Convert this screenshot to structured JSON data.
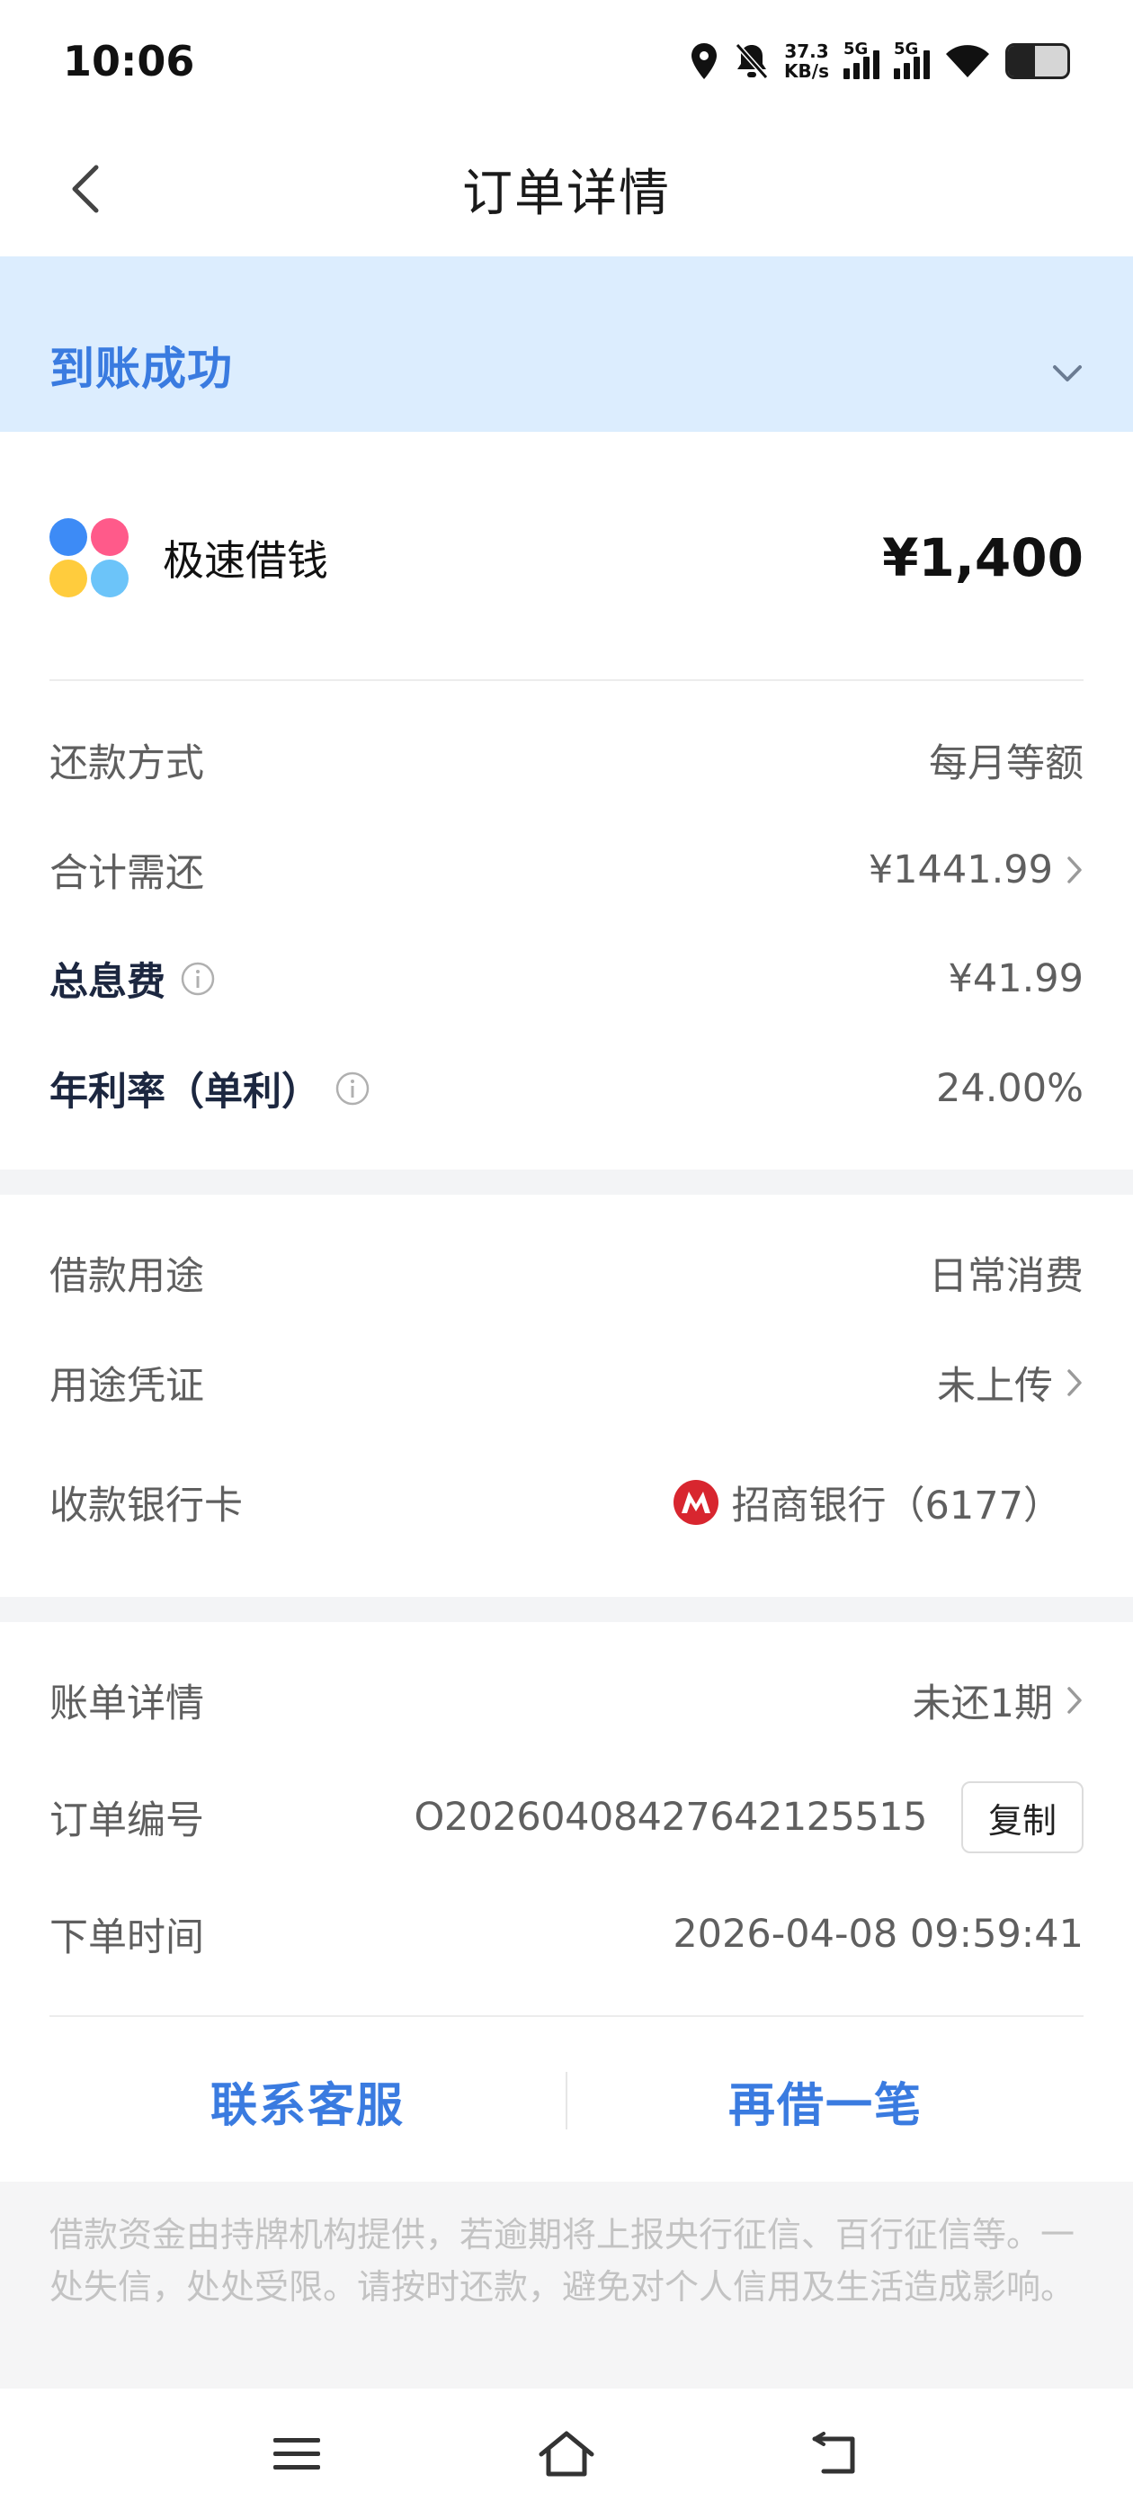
{
  "status_bar": {
    "time": "10:06",
    "net_speed_value": "37.3",
    "net_speed_unit": "KB/s",
    "signal_1": "5G",
    "signal_2": "5G",
    "battery_level": 0.45
  },
  "header": {
    "title": "订单详情"
  },
  "banner": {
    "status": "到账成功"
  },
  "product": {
    "name": "极速借钱",
    "amount": "¥1,400",
    "logo_colors": [
      "#3d8bf6",
      "#ff5a8a",
      "#ffcc3d",
      "#6cc4f9"
    ]
  },
  "section1": {
    "repay_method_label": "还款方式",
    "repay_method_value": "每月等额",
    "total_due_label": "合计需还",
    "total_due_value": "¥1441.99",
    "total_interest_label": "总息费",
    "total_interest_value": "¥41.99",
    "annual_rate_label": "年利率（单利）",
    "annual_rate_value": "24.00%"
  },
  "section2": {
    "purpose_label": "借款用途",
    "purpose_value": "日常消费",
    "voucher_label": "用途凭证",
    "voucher_value": "未上传",
    "bank_label": "收款银行卡",
    "bank_value": "招商银行（6177）"
  },
  "section3": {
    "bill_label": "账单详情",
    "bill_value": "未还1期",
    "order_no_label": "订单编号",
    "order_no_value": "O202604084276421255 15",
    "copy_label": "复制",
    "order_time_label": "下单时间",
    "order_time_value": "2026-04-08 09:59:41"
  },
  "actions": {
    "contact": "联系客服",
    "borrow_again": "再借一笔"
  },
  "disclaimer": {
    "text": "借款资金由持牌机构提供，若逾期将上报央行征信、百行征信等。一处失信，处处受限。请按时还款，避免对个人信用及生活造成影响。"
  },
  "colors": {
    "accent": "#3a7be0",
    "banner_bg": "#dcedfe",
    "bank_red": "#d8262f"
  }
}
